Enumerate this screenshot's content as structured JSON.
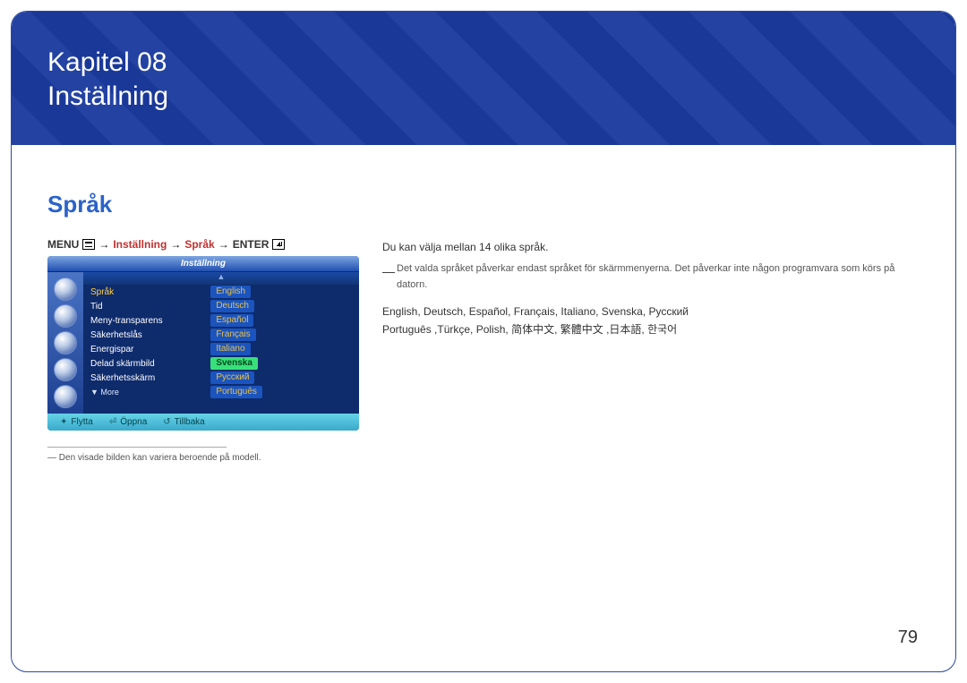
{
  "chapter": {
    "line1": "Kapitel 08",
    "line2": "Inställning"
  },
  "section_title": "Språk",
  "menu_path": {
    "menu_label": "MENU",
    "step1": "Inställning",
    "step2": "Språk",
    "enter_label": "ENTER"
  },
  "osd": {
    "title": "Inställning",
    "items": [
      {
        "label": "Språk",
        "value": "English",
        "selected_row": true,
        "selected_value": false
      },
      {
        "label": "Tid",
        "value": "Deutsch",
        "selected_row": false,
        "selected_value": false
      },
      {
        "label": "Meny-transparens",
        "value": "Español",
        "selected_row": false,
        "selected_value": false
      },
      {
        "label": "Säkerhetslås",
        "value": "Français",
        "selected_row": false,
        "selected_value": false
      },
      {
        "label": "Energispar",
        "value": "Italiano",
        "selected_row": false,
        "selected_value": false
      },
      {
        "label": "Delad skärmbild",
        "value": "Svenska",
        "selected_row": false,
        "selected_value": true
      },
      {
        "label": "Säkerhetsskärm",
        "value": "Русский",
        "selected_row": false,
        "selected_value": false
      }
    ],
    "more_label": "▼ More",
    "more_value": "Português",
    "footer": {
      "move": "Flytta",
      "enter": "Öppna",
      "return": "Tillbaka"
    }
  },
  "footnote": "Den visade bilden kan variera beroende på modell.",
  "body": {
    "line1": "Du kan välja mellan 14 olika språk.",
    "note": "Det valda språket påverkar endast språket för skärmmenyerna. Det påverkar inte någon programvara som körs på datorn.",
    "languages_line1": "English, Deutsch, Español, Français, Italiano, Svenska, Русский",
    "languages_line2": "Português ,Türkçe, Polish, 简体中文, 繁體中文 ,日本語, 한국어"
  },
  "page_number": "79"
}
